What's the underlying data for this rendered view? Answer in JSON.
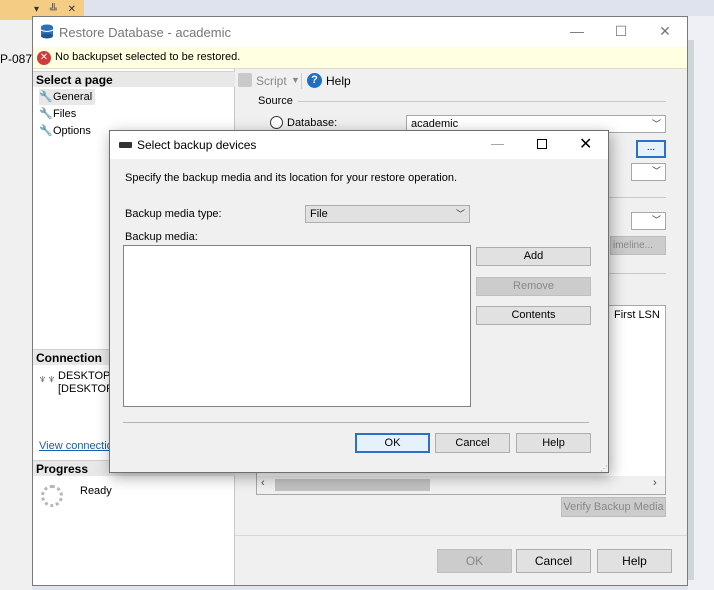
{
  "background": {
    "cut_text": "P-087"
  },
  "window": {
    "title": "Restore Database - academic",
    "error_message": "No backupset selected to be restored."
  },
  "left_pane": {
    "select_page_header": "Select a page",
    "pages": [
      {
        "label": "General"
      },
      {
        "label": "Files"
      },
      {
        "label": "Options"
      }
    ],
    "connection_header": "Connection",
    "connection_line1": "DESKTOP-",
    "connection_line2": "[DESKTOP",
    "view_connection_link": "View connection",
    "progress_header": "Progress",
    "progress_status": "Ready"
  },
  "toolbar": {
    "script_label": "Script",
    "help_label": "Help"
  },
  "source": {
    "section_label": "Source",
    "database_label": "Database:",
    "database_value": "academic",
    "browse_label": "...",
    "timeline_label": "imeline..."
  },
  "grid": {
    "visible_column": "First LSN"
  },
  "buttons": {
    "verify_backup_media": "Verify Backup Media",
    "ok": "OK",
    "cancel": "Cancel",
    "help": "Help"
  },
  "modal": {
    "title": "Select backup devices",
    "description": "Specify the backup media and its location for your restore operation.",
    "media_type_label": "Backup media type:",
    "media_type_value": "File",
    "media_label": "Backup media:",
    "add_label": "Add",
    "remove_label": "Remove",
    "contents_label": "Contents",
    "ok_label": "OK",
    "cancel_label": "Cancel",
    "help_label": "Help"
  },
  "colors": {
    "accent": "#2a72c7",
    "error_banner": "#ffffe1",
    "error_icon": "#d23a3a",
    "link": "#1a5fb4"
  }
}
